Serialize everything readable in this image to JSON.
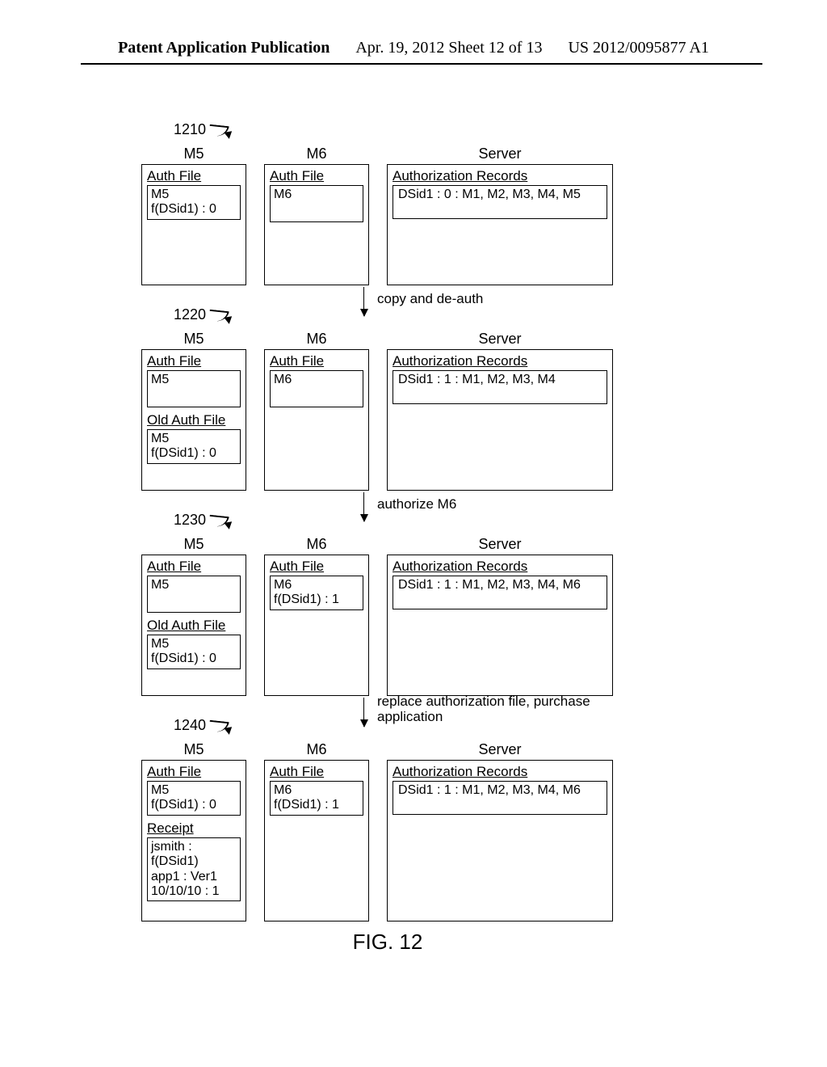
{
  "header": {
    "left": "Patent Application Publication",
    "center": "Apr. 19, 2012  Sheet 12 of 13",
    "right": "US 2012/0095877 A1"
  },
  "figure_caption": "FIG. 12",
  "column_headers": {
    "m5": "M5",
    "m6": "M6",
    "server": "Server"
  },
  "labels": {
    "auth_file": "Auth File",
    "old_auth_file": "Old Auth File",
    "auth_records": "Authorization Records",
    "receipt": "Receipt"
  },
  "steps": {
    "s1_to_s2": "copy and de-auth",
    "s2_to_s3": "authorize M6",
    "s3_to_s4": "replace authorization file, purchase application"
  },
  "states": [
    {
      "ref": "1210",
      "m5": {
        "auth": [
          "M5",
          "f(DSid1) : 0"
        ]
      },
      "m6": {
        "auth": [
          "M6"
        ]
      },
      "server": {
        "record": "DSid1 : 0 : M1, M2, M3, M4, M5"
      }
    },
    {
      "ref": "1220",
      "m5": {
        "auth": [
          "M5"
        ],
        "old_auth": [
          "M5",
          "f(DSid1) : 0"
        ]
      },
      "m6": {
        "auth": [
          "M6"
        ]
      },
      "server": {
        "record": "DSid1 : 1 : M1, M2, M3, M4"
      }
    },
    {
      "ref": "1230",
      "m5": {
        "auth": [
          "M5"
        ],
        "old_auth": [
          "M5",
          "f(DSid1) : 0"
        ]
      },
      "m6": {
        "auth": [
          "M6",
          "f(DSid1) : 1"
        ]
      },
      "server": {
        "record": "DSid1 : 1 : M1, M2, M3, M4, M6"
      }
    },
    {
      "ref": "1240",
      "m5": {
        "auth": [
          "M5",
          "f(DSid1) : 0"
        ],
        "receipt": [
          "jsmith : f(DSid1)",
          "app1 : Ver1",
          "10/10/10 : 1"
        ]
      },
      "m6": {
        "auth": [
          "M6",
          "f(DSid1) : 1"
        ]
      },
      "server": {
        "record": "DSid1 : 1 : M1, M2, M3, M4, M6"
      }
    }
  ]
}
